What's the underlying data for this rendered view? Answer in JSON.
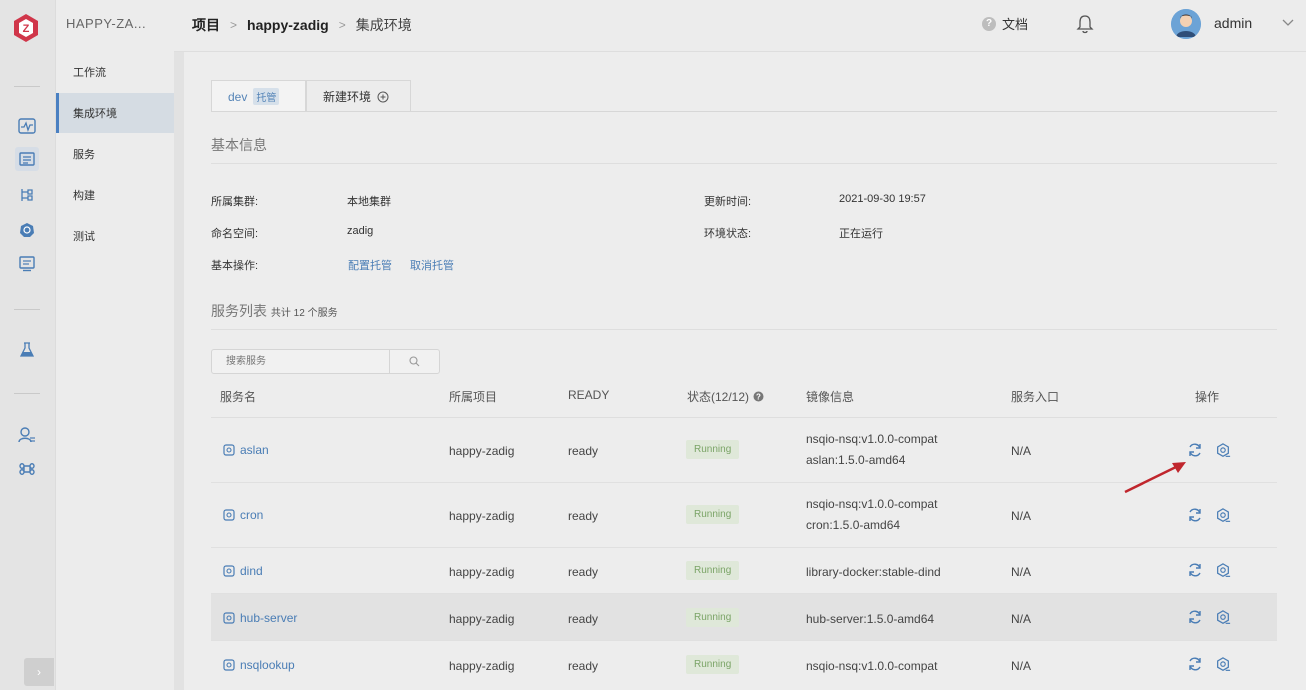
{
  "sidebar": {
    "project": "HAPPY-ZA...",
    "items": [
      {
        "label": "工作流"
      },
      {
        "label": "集成环境"
      },
      {
        "label": "服务"
      },
      {
        "label": "构建"
      },
      {
        "label": "测试"
      }
    ]
  },
  "header": {
    "breadcrumb": [
      "项目",
      "happy-zadig",
      "集成环境"
    ],
    "breadcrumb_sep": ">",
    "doc_label": "文档",
    "doc_icon": "?",
    "user": "admin"
  },
  "tabs": [
    {
      "label": "dev",
      "tag": "托管"
    },
    {
      "label": "新建环境"
    }
  ],
  "basic": {
    "title": "基本信息",
    "cluster_label": "所属集群:",
    "cluster_value": "本地集群",
    "namespace_label": "命名空间:",
    "namespace_value": "zadig",
    "ops_label": "基本操作:",
    "op1": "配置托管",
    "op2": "取消托管",
    "updated_label": "更新时间:",
    "updated_value": "2021-09-30 19:57",
    "status_label": "环境状态:",
    "status_value": "正在运行"
  },
  "services": {
    "title": "服务列表",
    "count": "共计 12 个服务",
    "search_placeholder": "搜索服务",
    "columns": [
      "服务名",
      "所属项目",
      "READY",
      "状态(12/12)",
      "镜像信息",
      "服务入口",
      "操作"
    ],
    "rows": [
      {
        "name": "aslan",
        "project": "happy-zadig",
        "ready": "ready",
        "status": "Running",
        "image1": "nsqio-nsq:v1.0.0-compat",
        "image2": "aslan:1.5.0-amd64",
        "entry": "N/A"
      },
      {
        "name": "cron",
        "project": "happy-zadig",
        "ready": "ready",
        "status": "Running",
        "image1": "nsqio-nsq:v1.0.0-compat",
        "image2": "cron:1.5.0-amd64",
        "entry": "N/A"
      },
      {
        "name": "dind",
        "project": "happy-zadig",
        "ready": "ready",
        "status": "Running",
        "image1": "library-docker:stable-dind",
        "image2": "",
        "entry": "N/A"
      },
      {
        "name": "hub-server",
        "project": "happy-zadig",
        "ready": "ready",
        "status": "Running",
        "image1": "hub-server:1.5.0-amd64",
        "image2": "",
        "entry": "N/A"
      },
      {
        "name": "nsqlookup",
        "project": "happy-zadig",
        "ready": "ready",
        "status": "Running",
        "image1": "nsqio-nsq:v1.0.0-compat",
        "image2": "",
        "entry": "N/A"
      }
    ]
  },
  "colors": {
    "accent": "#4a7db5",
    "running_bg": "#dfe8d9",
    "running_text": "#7ba467",
    "arrow": "#c0262d"
  }
}
